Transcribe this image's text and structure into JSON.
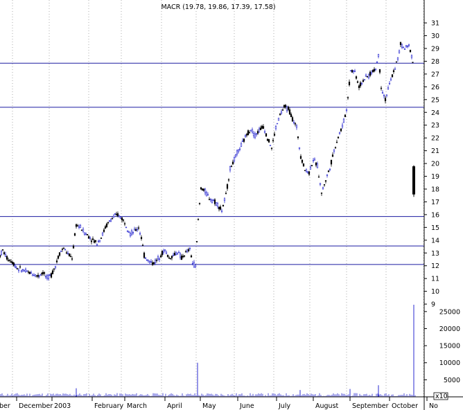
{
  "chart_data": {
    "type": "candlestick",
    "title": "MACR (19.78, 19.86, 17.39, 17.58)",
    "price_axis": {
      "ticks": [
        9,
        10,
        11,
        12,
        13,
        14,
        15,
        16,
        17,
        18,
        19,
        20,
        21,
        22,
        23,
        24,
        25,
        26,
        27,
        28,
        29,
        30,
        31
      ],
      "range": [
        8.3,
        31.6
      ]
    },
    "volume_axis": {
      "ticks": [
        5000,
        10000,
        15000,
        20000,
        25000
      ],
      "multiplier_label": "x10",
      "range": [
        0,
        27000
      ]
    },
    "x_axis": {
      "labels": [
        "ber",
        "December",
        "2003",
        "February",
        "March",
        "April",
        "May",
        "June",
        "July",
        "August",
        "September",
        "October",
        "No"
      ]
    },
    "horizontal_lines": [
      27.85,
      24.4,
      15.85,
      13.55,
      12.1
    ],
    "price_trend": [
      [
        0,
        12.8
      ],
      [
        4,
        13.2
      ],
      [
        10,
        12.6
      ],
      [
        18,
        12.3
      ],
      [
        25,
        11.8
      ],
      [
        35,
        11.6
      ],
      [
        45,
        11.4
      ],
      [
        55,
        11.2
      ],
      [
        62,
        11.5
      ],
      [
        68,
        11.0
      ],
      [
        74,
        11.3
      ],
      [
        80,
        12.0
      ],
      [
        86,
        13.0
      ],
      [
        92,
        13.4
      ],
      [
        98,
        12.9
      ],
      [
        104,
        12.6
      ],
      [
        110,
        15.2
      ],
      [
        116,
        15.0
      ],
      [
        122,
        14.6
      ],
      [
        128,
        14.3
      ],
      [
        134,
        14.0
      ],
      [
        140,
        13.8
      ],
      [
        146,
        14.2
      ],
      [
        152,
        15.0
      ],
      [
        158,
        15.5
      ],
      [
        164,
        15.8
      ],
      [
        170,
        16.0
      ],
      [
        176,
        15.7
      ],
      [
        182,
        15.2
      ],
      [
        188,
        14.5
      ],
      [
        194,
        14.7
      ],
      [
        200,
        15.0
      ],
      [
        204,
        14.2
      ],
      [
        208,
        12.8
      ],
      [
        214,
        12.4
      ],
      [
        220,
        12.2
      ],
      [
        226,
        12.4
      ],
      [
        232,
        12.9
      ],
      [
        238,
        13.2
      ],
      [
        244,
        12.6
      ],
      [
        250,
        12.8
      ],
      [
        256,
        13.1
      ],
      [
        262,
        12.6
      ],
      [
        268,
        13.0
      ],
      [
        274,
        13.3
      ],
      [
        278,
        12.2
      ],
      [
        282,
        12.0
      ],
      [
        286,
        15.6
      ],
      [
        290,
        18.1
      ],
      [
        296,
        17.8
      ],
      [
        302,
        17.3
      ],
      [
        308,
        17.1
      ],
      [
        314,
        16.8
      ],
      [
        320,
        16.3
      ],
      [
        326,
        17.5
      ],
      [
        332,
        19.6
      ],
      [
        338,
        20.3
      ],
      [
        344,
        21.0
      ],
      [
        350,
        21.6
      ],
      [
        356,
        22.3
      ],
      [
        362,
        22.7
      ],
      [
        368,
        22.2
      ],
      [
        374,
        22.6
      ],
      [
        380,
        22.9
      ],
      [
        386,
        22.0
      ],
      [
        392,
        21.2
      ],
      [
        398,
        22.8
      ],
      [
        404,
        23.8
      ],
      [
        410,
        24.4
      ],
      [
        416,
        24.3
      ],
      [
        422,
        23.5
      ],
      [
        428,
        22.8
      ],
      [
        434,
        20.6
      ],
      [
        440,
        19.5
      ],
      [
        446,
        19.3
      ],
      [
        452,
        20.3
      ],
      [
        458,
        19.8
      ],
      [
        464,
        17.7
      ],
      [
        470,
        18.7
      ],
      [
        476,
        19.7
      ],
      [
        482,
        21.0
      ],
      [
        488,
        22.1
      ],
      [
        494,
        22.9
      ],
      [
        500,
        24.2
      ],
      [
        506,
        27.3
      ],
      [
        512,
        27.2
      ],
      [
        518,
        26.0
      ],
      [
        524,
        26.5
      ],
      [
        530,
        26.8
      ],
      [
        536,
        27.1
      ],
      [
        542,
        27.4
      ],
      [
        546,
        28.5
      ],
      [
        550,
        26.0
      ],
      [
        556,
        25.0
      ],
      [
        562,
        26.2
      ],
      [
        568,
        27.2
      ],
      [
        574,
        28.2
      ],
      [
        578,
        29.3
      ],
      [
        584,
        29.0
      ],
      [
        590,
        29.2
      ],
      [
        594,
        28.5
      ],
      [
        597,
        27.3
      ]
    ],
    "last_candle": {
      "open": 19.78,
      "high": 19.86,
      "low": 17.39,
      "close": 17.58
    },
    "volume_spikes": [
      [
        285,
        10000
      ],
      [
        546,
        3400
      ],
      [
        597,
        27000
      ],
      [
        110,
        2500
      ],
      [
        433,
        2000
      ],
      [
        505,
        2300
      ]
    ]
  }
}
